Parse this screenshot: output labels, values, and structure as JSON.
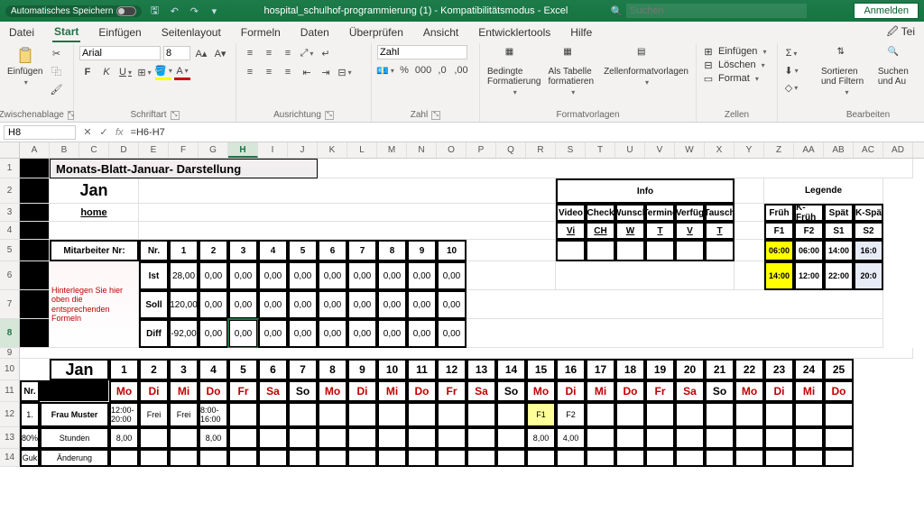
{
  "titlebar": {
    "autosave": "Automatisches Speichern",
    "filename": "hospital_schulhof-programmierung (1) - Kompatibilitätsmodus - Excel",
    "search_placeholder": "Suchen",
    "login": "Anmelden"
  },
  "menu": {
    "datei": "Datei",
    "start": "Start",
    "einfuegen": "Einfügen",
    "seitenlayout": "Seitenlayout",
    "formeln": "Formeln",
    "daten": "Daten",
    "ueberpruefen": "Überprüfen",
    "ansicht": "Ansicht",
    "entwickler": "Entwicklertools",
    "hilfe": "Hilfe",
    "tei": "Tei"
  },
  "ribbon": {
    "paste": "Einfügen",
    "clipboard": "Zwischenablage",
    "font_name": "Arial",
    "font_size": "8",
    "font": "Schriftart",
    "alignment": "Ausrichtung",
    "number_format": "Zahl",
    "number": "Zahl",
    "cond": "Bedingte Formatierung",
    "astable": "Als Tabelle formatieren",
    "cellstyles": "Zellenformatvorlagen",
    "styles": "Formatvorlagen",
    "insert": "Einfügen",
    "delete": "Löschen",
    "format": "Format",
    "cells": "Zellen",
    "sort": "Sortieren und Filtern",
    "find": "Suchen und Au",
    "editing": "Bearbeiten"
  },
  "namebox": {
    "cell": "H8",
    "formula": "=H6-H7"
  },
  "cols": [
    "A",
    "B",
    "C",
    "D",
    "E",
    "F",
    "G",
    "H",
    "I",
    "J",
    "K",
    "L",
    "M",
    "N",
    "O",
    "P",
    "Q",
    "R",
    "S",
    "T",
    "U",
    "V",
    "W",
    "X",
    "Y",
    "Z",
    "AA",
    "AB",
    "AC",
    "AD"
  ],
  "sheet": {
    "title": "Monats-Blatt-Januar- Darstellung",
    "jan": "Jan",
    "home": "home",
    "info": "Info",
    "info_cols": [
      "Video",
      "Check",
      "Wunsch",
      "Termine",
      "Verfüg",
      "Tausch"
    ],
    "info_short": [
      "Vi",
      "CH",
      "W",
      "T",
      "V",
      "T"
    ],
    "legend": "Legende",
    "legend_cols": [
      "Früh",
      "K-Früh",
      "Spät",
      "K-Spä"
    ],
    "legend_short": [
      "F1",
      "F2",
      "S1",
      "S2"
    ],
    "legend_row1": [
      "06:00",
      "06:00",
      "14:00",
      "16:0"
    ],
    "legend_row2": [
      "14:00",
      "12:00",
      "22:00",
      "20:0"
    ],
    "mitarbeiter": "Mitarbeiter Nr:",
    "nr": "Nr.",
    "ist": "Ist",
    "soll": "Soll",
    "diff": "Diff",
    "hint": "Hinterlegen Sie hier oben die entsprechenden Formeln",
    "nums": [
      "1",
      "2",
      "3",
      "4",
      "5",
      "6",
      "7",
      "8",
      "9",
      "10"
    ],
    "ist_vals": [
      "28,00",
      "0,00",
      "0,00",
      "0,00",
      "0,00",
      "0,00",
      "0,00",
      "0,00",
      "0,00",
      "0,00"
    ],
    "soll_vals": [
      "120,00",
      "0,00",
      "0,00",
      "0,00",
      "0,00",
      "0,00",
      "0,00",
      "0,00",
      "0,00",
      "0,00"
    ],
    "diff_vals": [
      "-92,00",
      "0,00",
      "0,00",
      "0,00",
      "0,00",
      "0,00",
      "0,00",
      "0,00",
      "0,00",
      "0,00"
    ],
    "days": [
      "1",
      "2",
      "3",
      "4",
      "5",
      "6",
      "7",
      "8",
      "9",
      "10",
      "11",
      "12",
      "13",
      "14",
      "15",
      "16",
      "17",
      "18",
      "19",
      "20",
      "21",
      "22",
      "23",
      "24",
      "25"
    ],
    "weekdays": [
      "Mo",
      "Di",
      "Mi",
      "Do",
      "Fr",
      "Sa",
      "So",
      "Mo",
      "Di",
      "Mi",
      "Do",
      "Fr",
      "Sa",
      "So",
      "Mo",
      "Di",
      "Mi",
      "Do",
      "Fr",
      "Sa",
      "So",
      "Mo",
      "Di",
      "Mi",
      "Do"
    ],
    "row_nr": "Nr.",
    "frau": "Frau Muster",
    "schedule": [
      "12:00-20:00",
      "Frei",
      "Frei",
      "8:00-16:00",
      "",
      "",
      "",
      "",
      "",
      "",
      "",
      "",
      "",
      "",
      "F1",
      "F2",
      "",
      "",
      "",
      "",
      "",
      "",
      "",
      "",
      ""
    ],
    "stunden": "Stunden",
    "stunden_vals": [
      "8,00",
      "",
      "",
      "8,00",
      "",
      "",
      "",
      "",
      "",
      "",
      "",
      "",
      "",
      "",
      "8,00",
      "4,00",
      "",
      "",
      "",
      "",
      "",
      "",
      "",
      "",
      ""
    ],
    "pct": "80%",
    "one": "1.",
    "aenderung": "Änderung",
    "guk": "Guk"
  }
}
